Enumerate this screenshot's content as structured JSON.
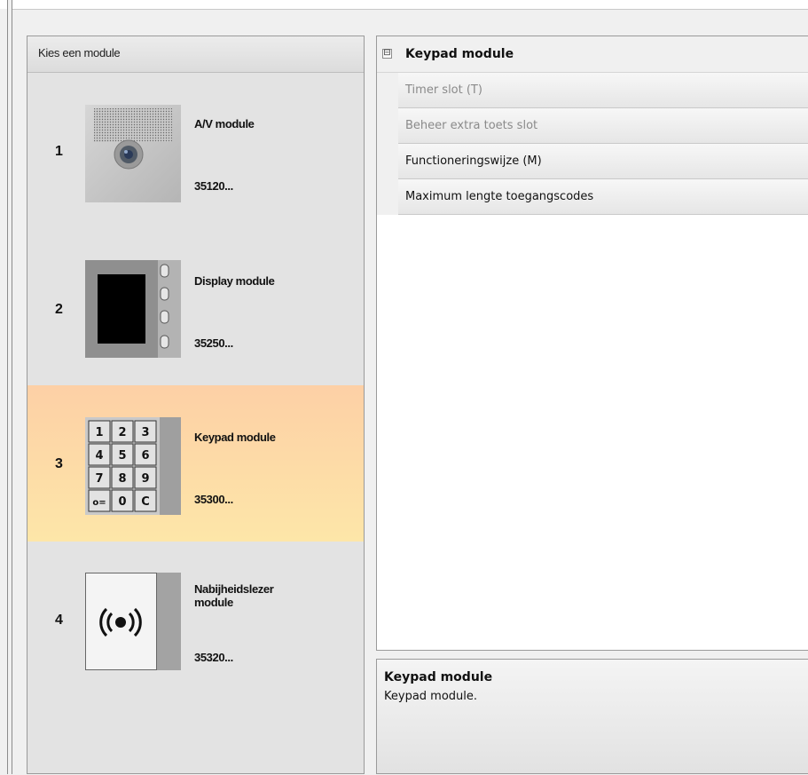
{
  "module_chooser": {
    "header": "Kies een module",
    "modules": [
      {
        "number": "1",
        "name": "A/V module",
        "code": "35120...",
        "icon": "av-module-image"
      },
      {
        "number": "2",
        "name": "Display module",
        "code": "35250...",
        "icon": "display-module-image"
      },
      {
        "number": "3",
        "name": "Keypad module",
        "code": "35300...",
        "icon": "keypad-module-image",
        "selected": true
      },
      {
        "number": "4",
        "name": "Nabijheidslezer module",
        "code": "35320...",
        "icon": "proximity-reader-image"
      }
    ],
    "keypad_keys": [
      "1",
      "2",
      "3",
      "4",
      "5",
      "6",
      "7",
      "8",
      "9",
      "o=",
      "0",
      "C"
    ],
    "selected_color_top": "#fdd0a6",
    "selected_color_bottom": "#fde6a8"
  },
  "property_grid": {
    "category": "Keypad module",
    "collapse_glyph": "⊟",
    "properties": [
      {
        "label": "Timer slot (T)",
        "enabled": false
      },
      {
        "label": "Beheer extra toets slot",
        "enabled": false
      },
      {
        "label": "Functioneringswijze (M)",
        "enabled": true
      },
      {
        "label": "Maximum lengte toegangscodes",
        "enabled": true
      }
    ]
  },
  "description": {
    "title": "Keypad module",
    "text": "Keypad module."
  }
}
